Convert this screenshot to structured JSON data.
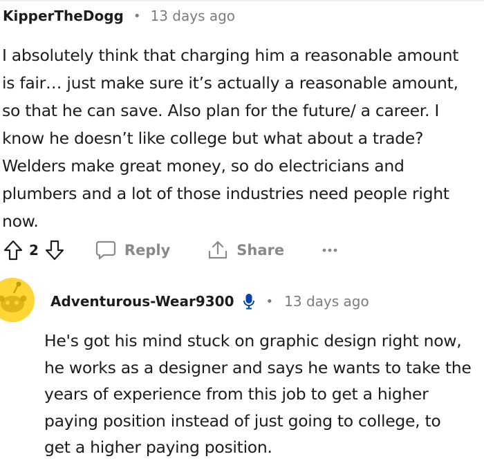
{
  "comment1": {
    "username": "KipperTheDogg",
    "separator": "•",
    "timestamp": "13 days ago",
    "body_lines": [
      "I absolutely think that charging him a reasonable amount",
      "is fair… just make sure it’s actually a reasonable amount,",
      "so that he can save. Also plan for the future/ a career. I",
      "know he doesn’t like college but what about a trade?",
      "Welders make great money, so do electricians and",
      "plumbers and a lot of those industries need people right",
      "now."
    ],
    "vote_count": "2",
    "reply_label": "Reply",
    "share_label": "Share",
    "more_label": "•••"
  },
  "comment2": {
    "username": "Adventurous-Wear9300",
    "separator": "•",
    "timestamp": "13 days ago",
    "body_lines": [
      "He's got his mind stuck on graphic design right now,",
      "he works as a designer and says he wants to take the",
      "years of experience from this job to get a higher",
      "paying position instead of just going to college, to",
      "get a higher paying position."
    ]
  },
  "colors": {
    "text": "#1c1c1c",
    "meta": "#7c7c7c",
    "action": "#878a8c",
    "avatar_bg": "#ffd635",
    "mic_icon": "#0045ac"
  },
  "icons": {
    "upvote": "upvote-arrow-icon",
    "downvote": "downvote-arrow-icon",
    "reply": "speech-bubble-icon",
    "share": "share-upload-icon",
    "more": "more-dots-icon",
    "mic": "microphone-icon",
    "avatar": "snoo-avatar-icon"
  }
}
